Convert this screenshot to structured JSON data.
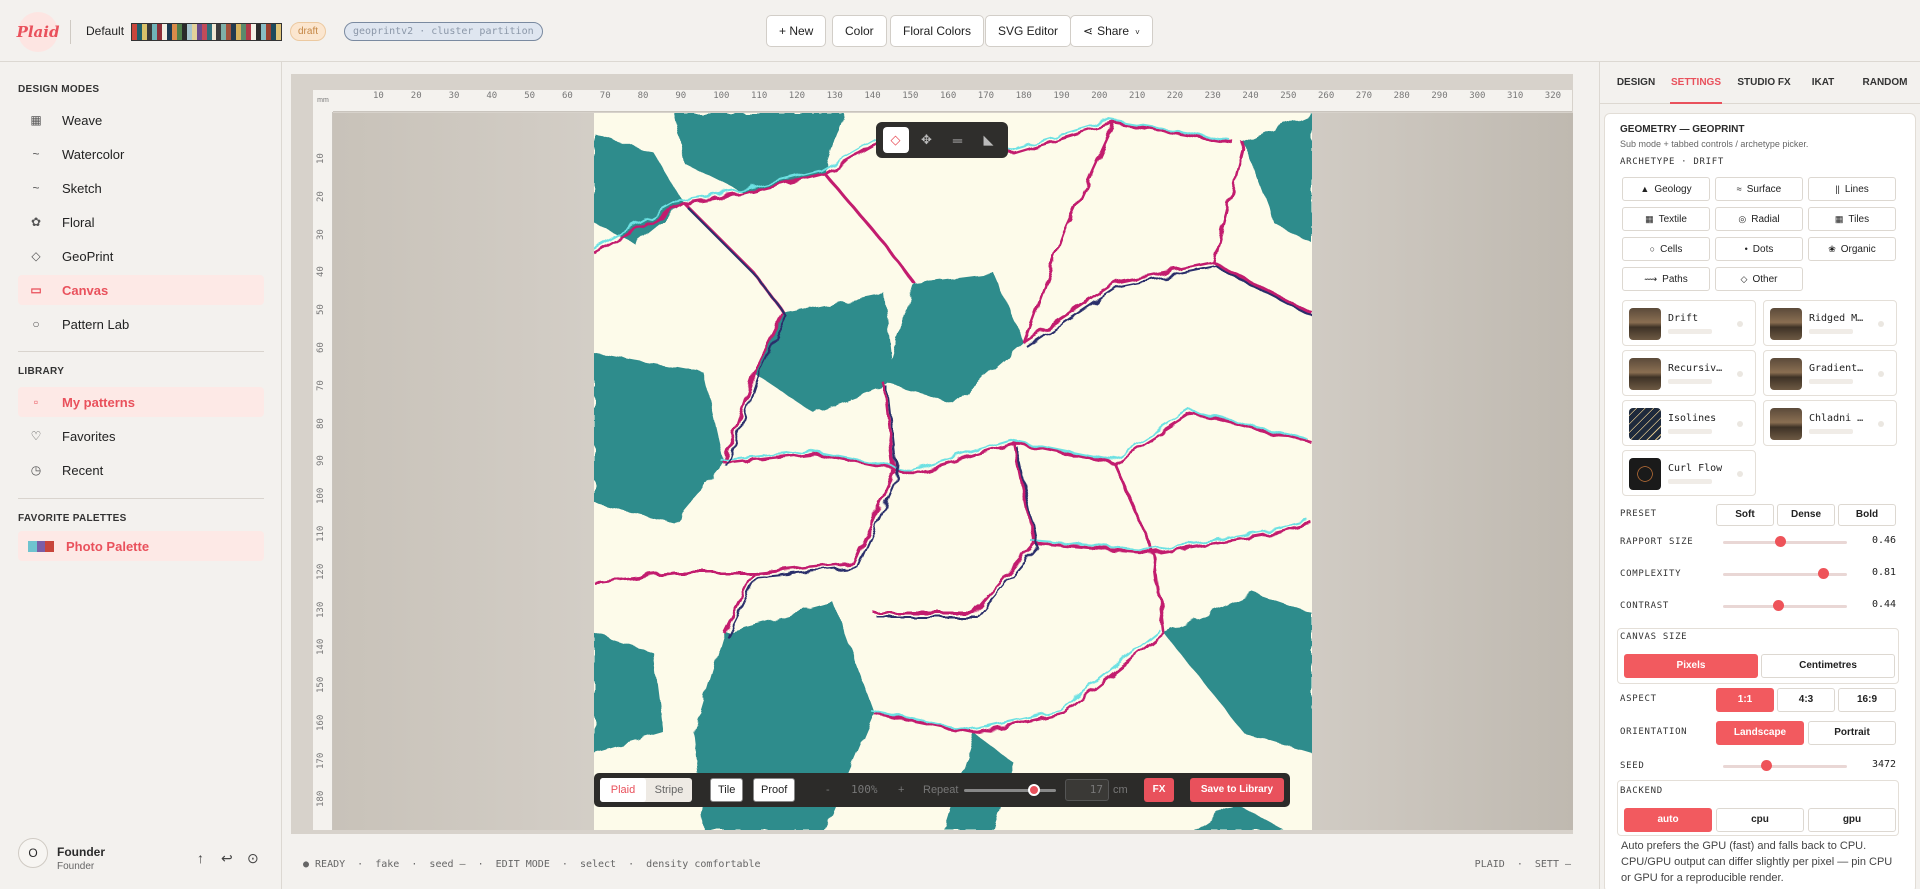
{
  "header": {
    "logo_text": "Plaid",
    "design_name": "Default",
    "draft_badge": "draft",
    "mode_tag": "geoprintv2 · cluster partition",
    "swatch_colors": [
      "#c8463c",
      "#1e5f6b",
      "#d9c26a",
      "#3a3a3a",
      "#6fb3b8",
      "#8c2f39",
      "#f2efe4",
      "#1b3a52",
      "#d98b4a",
      "#4f7f4a",
      "#2a2a2a",
      "#a8c6cf",
      "#e3d19a",
      "#6b4a8c",
      "#c24b5a",
      "#2f6f7a",
      "#efe8d4",
      "#3c3c3c",
      "#7fb0a8",
      "#a3523c",
      "#223a4f",
      "#d6b25e",
      "#5a8a6c",
      "#b03a48",
      "#f4f1e6",
      "#2c2c2c",
      "#88bcc4",
      "#9a3f2f",
      "#1d4a5c",
      "#e0c57a"
    ],
    "buttons": {
      "new": "+ New",
      "color": "Color",
      "floral_colors": "Floral Colors",
      "svg_editor": "SVG Editor",
      "share": "Share"
    }
  },
  "sidebar": {
    "design_modes_title": "DESIGN MODES",
    "modes": [
      {
        "label": "Weave",
        "icon": "grid-icon",
        "glyph": "▦",
        "active": false
      },
      {
        "label": "Watercolor",
        "icon": "brush-icon",
        "glyph": "~",
        "active": false
      },
      {
        "label": "Sketch",
        "icon": "pencil-icon",
        "glyph": "~",
        "active": false
      },
      {
        "label": "Floral",
        "icon": "flower-icon",
        "glyph": "✿",
        "active": false
      },
      {
        "label": "GeoPrint",
        "icon": "diamond-icon",
        "glyph": "◇",
        "active": false
      },
      {
        "label": "Canvas",
        "icon": "canvas-icon",
        "glyph": "▭",
        "active": true
      },
      {
        "label": "Pattern Lab",
        "icon": "circle-icon",
        "glyph": "○",
        "active": false
      }
    ],
    "library_title": "LIBRARY",
    "library": [
      {
        "label": "My patterns",
        "icon": "folder-icon",
        "glyph": "▫",
        "active": true
      },
      {
        "label": "Favorites",
        "icon": "heart-icon",
        "glyph": "♡",
        "active": false
      },
      {
        "label": "Recent",
        "icon": "clock-icon",
        "glyph": "◷",
        "active": false
      }
    ],
    "favorite_palettes_title": "FAVORITE PALETTES",
    "palette": {
      "label": "Photo Palette",
      "colors": [
        "#6fc3cf",
        "#7a5ea8",
        "#c8463c"
      ]
    },
    "user": {
      "initial": "O",
      "name": "Founder",
      "role": "Founder"
    }
  },
  "canvas": {
    "ruler_corner": "mm",
    "ruler_top": [
      "10",
      "20",
      "30",
      "40",
      "50",
      "60",
      "70",
      "80",
      "90",
      "100",
      "110",
      "120",
      "130",
      "140",
      "150",
      "160",
      "170",
      "180",
      "190",
      "200",
      "210",
      "220",
      "230",
      "240",
      "250",
      "260",
      "270",
      "280",
      "290",
      "300",
      "310",
      "320"
    ],
    "ruler_left": [
      "10",
      "20",
      "30",
      "40",
      "50",
      "60",
      "70",
      "80",
      "90",
      "100",
      "110",
      "120",
      "130",
      "140",
      "150",
      "160",
      "170",
      "180"
    ],
    "tools": [
      {
        "name": "select-tool-icon",
        "glyph": "◇",
        "active": true
      },
      {
        "name": "move-tool-icon",
        "glyph": "✥",
        "active": false
      },
      {
        "name": "line-tool-icon",
        "glyph": "═",
        "active": false
      },
      {
        "name": "ruler-tool-icon",
        "glyph": "◣",
        "active": false
      }
    ],
    "bottom_bar": {
      "plaid": "Plaid",
      "stripe": "Stripe",
      "tile": "Tile",
      "proof": "Proof",
      "zoom_out": "-",
      "zoom": "100%",
      "zoom_in": "+",
      "repeat_label": "Repeat",
      "repeat_value": "17",
      "repeat_unit": "cm",
      "repeat_slider_position": 0.76,
      "fx": "FX",
      "save": "Save to Library"
    }
  },
  "statusbar": {
    "left": "● READY  ·  fake  ·  seed —  ·  EDIT MODE  ·  select  ·  density comfortable",
    "right": "PLAID  ·  SETT —"
  },
  "panel": {
    "tabs": [
      {
        "label": "DESIGN",
        "active": false
      },
      {
        "label": "SETTINGS",
        "active": true
      },
      {
        "label": "STUDIO FX",
        "active": false
      },
      {
        "label": "IKAT",
        "active": false
      },
      {
        "label": "RANDOM",
        "active": false
      }
    ],
    "title": "GEOMETRY — GEOPRINT",
    "subtitle": "Sub mode + tabbed controls / archetype picker.",
    "archetype_label": "ARCHETYPE · DRIFT",
    "archetypes": [
      {
        "label": "Geology",
        "glyph": "▲"
      },
      {
        "label": "Surface",
        "glyph": "≈"
      },
      {
        "label": "Lines",
        "glyph": "||"
      },
      {
        "label": "Textile",
        "glyph": "▦"
      },
      {
        "label": "Radial",
        "glyph": "◎"
      },
      {
        "label": "Tiles",
        "glyph": "▦"
      },
      {
        "label": "Cells",
        "glyph": "○"
      },
      {
        "label": "Dots",
        "glyph": "•"
      },
      {
        "label": "Organic",
        "glyph": "❀"
      },
      {
        "label": "Paths",
        "glyph": "⟿"
      },
      {
        "label": "Other",
        "glyph": "◇"
      }
    ],
    "presets_cards": [
      {
        "label": "Drift",
        "thumb": "brown"
      },
      {
        "label": "Ridged M…",
        "thumb": "brown"
      },
      {
        "label": "Recursiv…",
        "thumb": "brown"
      },
      {
        "label": "Gradient…",
        "thumb": "brown"
      },
      {
        "label": "Isolines",
        "thumb": "navy"
      },
      {
        "label": "Chladni …",
        "thumb": "brown"
      },
      {
        "label": "Curl Flow",
        "thumb": "dark"
      }
    ],
    "preset_label": "PRESET",
    "preset_options": [
      "Soft",
      "Dense",
      "Bold"
    ],
    "sliders": [
      {
        "label": "RAPPORT SIZE",
        "value": "0.46",
        "fraction": 0.46
      },
      {
        "label": "COMPLEXITY",
        "value": "0.81",
        "fraction": 0.81
      },
      {
        "label": "CONTRAST",
        "value": "0.44",
        "fraction": 0.44
      }
    ],
    "canvas_size_label": "CANVAS SIZE",
    "units": [
      {
        "label": "Pixels",
        "active": true
      },
      {
        "label": "Centimetres",
        "active": false
      }
    ],
    "aspect_label": "ASPECT",
    "aspects": [
      {
        "label": "1:1",
        "active": true
      },
      {
        "label": "4:3",
        "active": false
      },
      {
        "label": "16:9",
        "active": false
      }
    ],
    "orientation_label": "ORIENTATION",
    "orientations": [
      {
        "label": "Landscape",
        "active": true
      },
      {
        "label": "Portrait",
        "active": false
      }
    ],
    "seed_label": "SEED",
    "seed_value": "3472",
    "seed_fraction": 0.35,
    "backend_label": "BACKEND",
    "backends": [
      {
        "label": "auto",
        "active": true
      },
      {
        "label": "cpu",
        "active": false
      },
      {
        "label": "gpu",
        "active": false
      }
    ],
    "backend_note": "Auto prefers the GPU (fast) and falls back to CPU. CPU/GPU output can differ slightly per pixel — pin CPU or GPU for a reproducible render."
  },
  "colors": {
    "accent": "#e9515c",
    "pattern_teal": "#2f8c8c",
    "pattern_cream": "#fdfbea"
  }
}
